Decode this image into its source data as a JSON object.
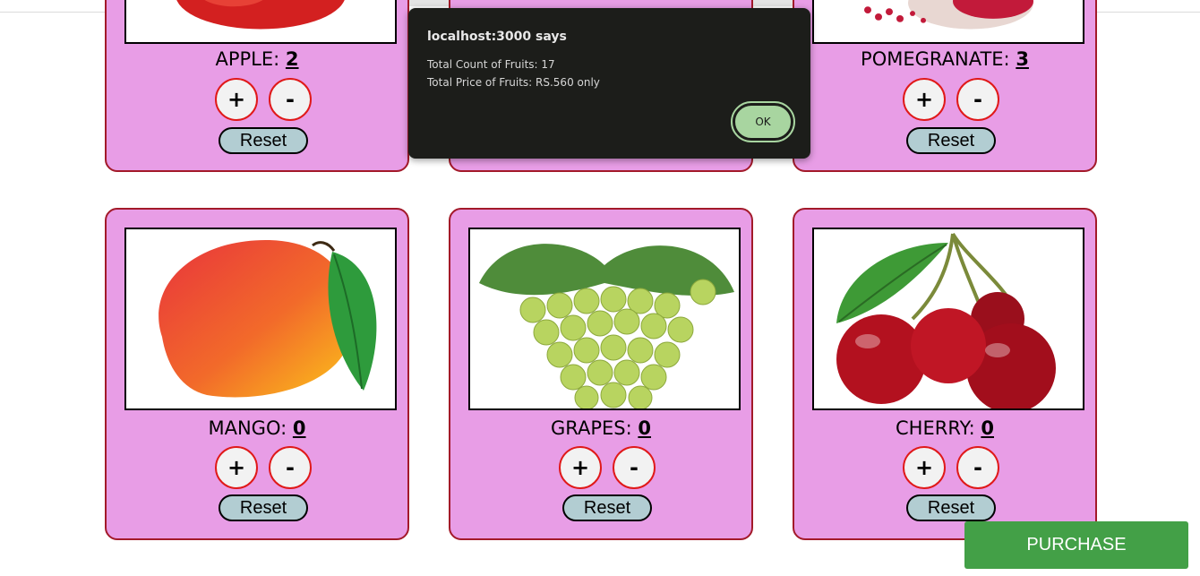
{
  "top_row": [
    {
      "name": "APPLE",
      "count": "2"
    },
    {
      "name": "",
      "count": ""
    },
    {
      "name": "POMEGRANATE",
      "count": "3"
    }
  ],
  "bottom_row": [
    {
      "name": "MANGO",
      "count": "0"
    },
    {
      "name": "GRAPES",
      "count": "0"
    },
    {
      "name": "CHERRY",
      "count": "0"
    }
  ],
  "buttons": {
    "plus": "+",
    "minus": "-",
    "reset": "Reset",
    "purchase": "PURCHASE"
  },
  "dialog": {
    "title": "localhost:3000 says",
    "line1": "Total Count of Fruits: 17",
    "line2": "Total Price of Fruits: RS.560 only",
    "ok": "OK"
  },
  "colors": {
    "card_bg": "#e89de6",
    "card_border": "#a31a2a",
    "purchase_bg": "#43a047"
  },
  "icons": {
    "apple": "apple-image",
    "pomegranate": "pomegranate-image",
    "mango": "mango-image",
    "grapes": "grapes-image",
    "cherry": "cherry-image"
  }
}
